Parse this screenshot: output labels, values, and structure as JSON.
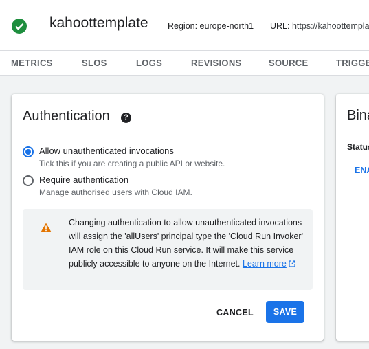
{
  "header": {
    "service_name": "kahoottemplate",
    "region_label": "Region: europe-north1",
    "url_label": "URL:",
    "url_value": "https://kahoottemplate"
  },
  "tabs": [
    {
      "label": "METRICS"
    },
    {
      "label": "SLOS"
    },
    {
      "label": "LOGS"
    },
    {
      "label": "REVISIONS"
    },
    {
      "label": "SOURCE"
    },
    {
      "label": "TRIGGERS"
    }
  ],
  "auth_card": {
    "title": "Authentication",
    "help_icon": "?",
    "options": [
      {
        "label": "Allow unauthenticated invocations",
        "description": "Tick this if you are creating a public API or website.",
        "selected": true
      },
      {
        "label": "Require authentication",
        "description": "Manage authorised users with Cloud IAM.",
        "selected": false
      }
    ],
    "warning": {
      "icon": "warning-icon",
      "text": "Changing authentication to allow unauthenticated invocations will assign the 'allUsers' principal type the 'Cloud Run Invoker' IAM role on this Cloud Run service. It will make this service publicly accessible to anyone on the Internet.",
      "link_text": "Learn more"
    },
    "cancel_label": "CANCEL",
    "save_label": "SAVE"
  },
  "binary_card": {
    "title": "Binary Authorization",
    "status_label": "Status",
    "enable_label": "ENABLE"
  },
  "colors": {
    "accent": "#1a73e8",
    "success": "#1e8e3e",
    "warning": "#e37400"
  }
}
